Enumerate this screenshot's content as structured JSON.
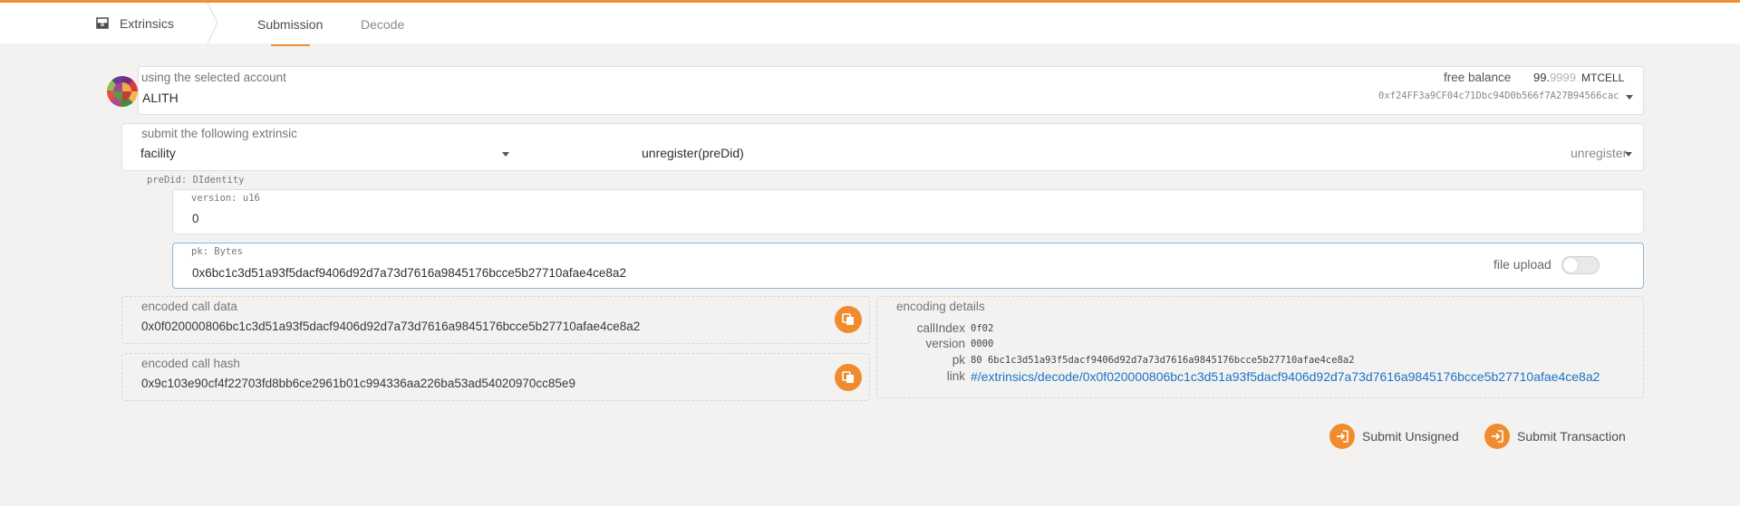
{
  "header": {
    "app_title": "Extrinsics",
    "tabs": [
      {
        "label": "Submission",
        "active": true
      },
      {
        "label": "Decode",
        "active": false
      }
    ]
  },
  "account": {
    "label": "using the selected account",
    "name": "ALITH",
    "balance_label": "free balance",
    "balance_int": "99.",
    "balance_frac": "9999",
    "balance_unit": "MTCELL",
    "address": "0xf24FF3a9CF04c71Dbc94D0b566f7A27B94566cac"
  },
  "extrinsic": {
    "label": "submit the following extrinsic",
    "pallet": "facility",
    "call": "unregister(preDid)",
    "method": "unregister"
  },
  "params": {
    "preDid_label": "preDid: DIdentity",
    "version_label": "version: u16",
    "version_value": "0",
    "pk_label": "pk: Bytes",
    "pk_value": "0x6bc1c3d51a93f5dacf9406d92d7a73d7616a9845176bcce5b27710afae4ce8a2",
    "file_upload_label": "file upload"
  },
  "encoded": {
    "call_data_label": "encoded call data",
    "call_data": "0x0f020000806bc1c3d51a93f5dacf9406d92d7a73d7616a9845176bcce5b27710afae4ce8a2",
    "call_hash_label": "encoded call hash",
    "call_hash": "0x9c103e90cf4f22703fd8bb6ce2961b01c994336aa226ba53ad54020970cc85e9"
  },
  "details": {
    "title": "encoding details",
    "rows": [
      {
        "key": "callIndex",
        "value": "0f02"
      },
      {
        "key": "version",
        "value": "0000"
      },
      {
        "key": "pk",
        "value": "80 6bc1c3d51a93f5dacf9406d92d7a73d7616a9845176bcce5b27710afae4ce8a2"
      }
    ],
    "link_key": "link",
    "link_value": "#/extrinsics/decode/0x0f020000806bc1c3d51a93f5dacf9406d92d7a73d7616a9845176bcce5b27710afae4ce8a2"
  },
  "actions": {
    "submit_unsigned": "Submit Unsigned",
    "submit_transaction": "Submit Transaction"
  },
  "colors": {
    "accent": "#f19135",
    "link": "#1a74c9",
    "background": "#f3f2f1"
  }
}
